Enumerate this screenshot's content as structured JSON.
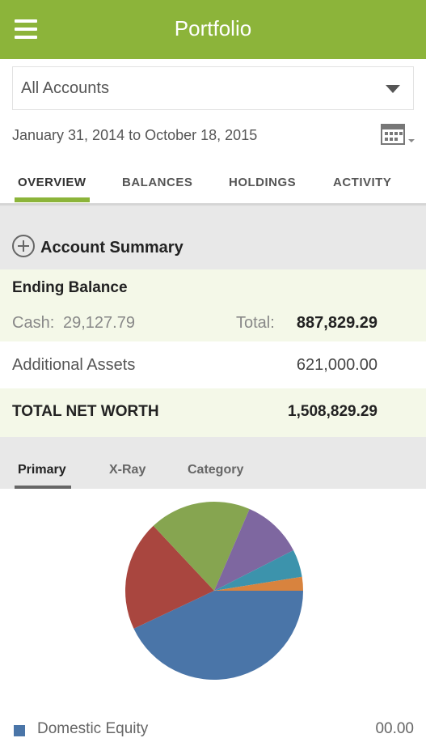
{
  "app": {
    "title": "Portfolio"
  },
  "account_select": {
    "value": "All Accounts"
  },
  "date_range": "January 31, 2014 to October 18, 2015",
  "tabs": [
    {
      "label": "OVERVIEW",
      "active": true
    },
    {
      "label": "BALANCES",
      "active": false
    },
    {
      "label": "HOLDINGS",
      "active": false
    },
    {
      "label": "ACTIVITY",
      "active": false
    }
  ],
  "summary": {
    "title": "Account Summary",
    "ending_balance_label": "Ending Balance",
    "cash_label": "Cash:",
    "cash_value": "29,127.79",
    "total_label": "Total:",
    "total_value": "887,829.29",
    "additional_assets_label": "Additional Assets",
    "additional_assets_value": "621,000.00",
    "net_worth_label": "TOTAL NET WORTH",
    "net_worth_value": "1,508,829.29"
  },
  "chart_tabs": [
    {
      "label": "Primary",
      "active": true
    },
    {
      "label": "X-Ray",
      "active": false
    },
    {
      "label": "Category",
      "active": false
    }
  ],
  "chart_data": {
    "type": "pie",
    "slices": [
      {
        "value": 43.0,
        "color": "#4a75a8"
      },
      {
        "value": 20.0,
        "color": "#a9463f"
      },
      {
        "value": 18.5,
        "color": "#86a550"
      },
      {
        "value": 11.0,
        "color": "#7e67a0"
      },
      {
        "value": 5.0,
        "color": "#3c93ac"
      },
      {
        "value": 2.5,
        "color": "#d8833e"
      }
    ]
  },
  "legend": {
    "label": "Domestic Equity",
    "value": "00.00"
  }
}
